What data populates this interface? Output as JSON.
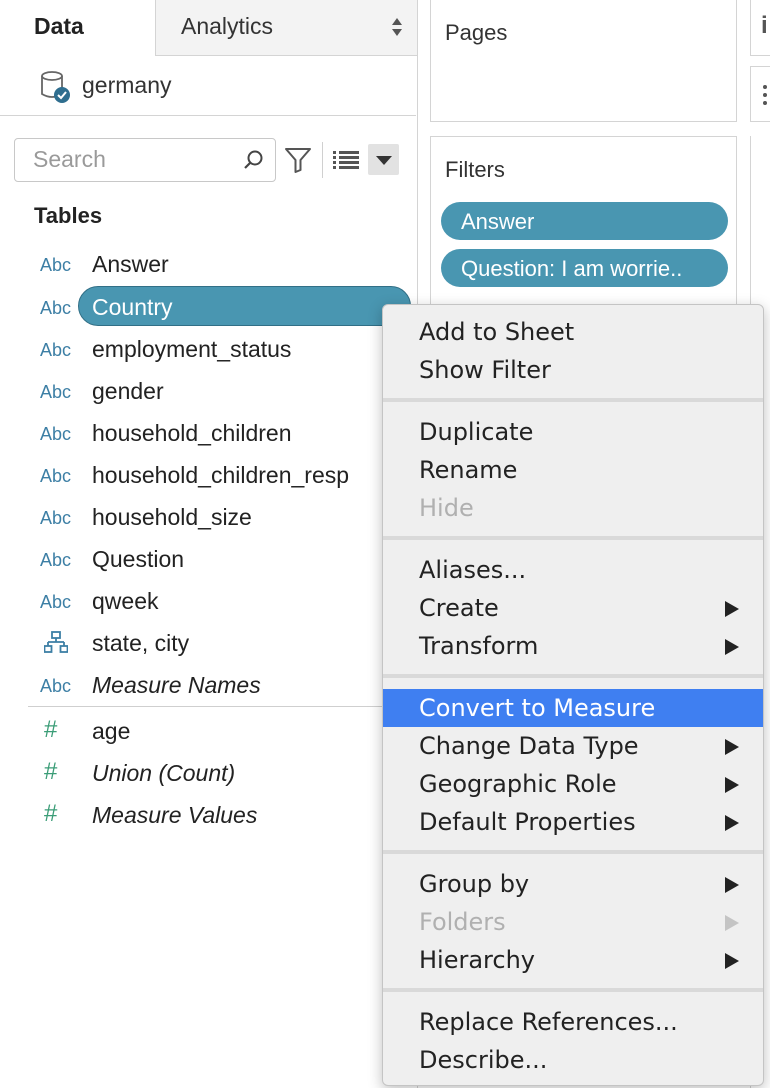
{
  "data_pane": {
    "tab_data": "Data",
    "tab_analytics": "Analytics",
    "datasource": "germany",
    "search_placeholder": "Search",
    "tables_title": "Tables",
    "fields": [
      {
        "type": "Abc",
        "name": "Answer"
      },
      {
        "type": "Abc",
        "name": "Country"
      },
      {
        "type": "Abc",
        "name": "employment_status"
      },
      {
        "type": "Abc",
        "name": "gender"
      },
      {
        "type": "Abc",
        "name": "household_children"
      },
      {
        "type": "Abc",
        "name": "household_children_resp"
      },
      {
        "type": "Abc",
        "name": "household_size"
      },
      {
        "type": "Abc",
        "name": "Question"
      },
      {
        "type": "Abc",
        "name": "qweek"
      },
      {
        "type": "hierarchy-icon",
        "name": "state, city"
      },
      {
        "type": "Abc",
        "name": "Measure Names"
      }
    ],
    "measures": [
      {
        "type": "#",
        "name": "age"
      },
      {
        "type": "#",
        "name": "Union (Count)"
      },
      {
        "type": "#",
        "name": "Measure Values"
      }
    ]
  },
  "shelves": {
    "pages_title": "Pages",
    "filters_title": "Filters",
    "filters": [
      "Answer",
      "Question: I am worrie.."
    ],
    "right_strip_glyph": "i"
  },
  "context_menu": {
    "groups": [
      [
        {
          "label": "Add to Sheet"
        },
        {
          "label": "Show Filter"
        }
      ],
      [
        {
          "label": "Duplicate"
        },
        {
          "label": "Rename"
        },
        {
          "label": "Hide",
          "disabled": true
        }
      ],
      [
        {
          "label": "Aliases..."
        },
        {
          "label": "Create",
          "submenu": true
        },
        {
          "label": "Transform",
          "submenu": true
        }
      ],
      [
        {
          "label": "Convert to Measure",
          "highlighted": true
        },
        {
          "label": "Change Data Type",
          "submenu": true
        },
        {
          "label": "Geographic Role",
          "submenu": true
        },
        {
          "label": "Default Properties",
          "submenu": true
        }
      ],
      [
        {
          "label": "Group by",
          "submenu": true
        },
        {
          "label": "Folders",
          "submenu": true,
          "disabled": true
        },
        {
          "label": "Hierarchy",
          "submenu": true
        }
      ],
      [
        {
          "label": "Replace References..."
        },
        {
          "label": "Describe..."
        }
      ]
    ]
  },
  "colors": {
    "pill_blue": "#4996b1",
    "menu_highlight": "#3f7ff1",
    "dimension_type": "#3d7fa5",
    "measure_type": "#3b9d77"
  }
}
